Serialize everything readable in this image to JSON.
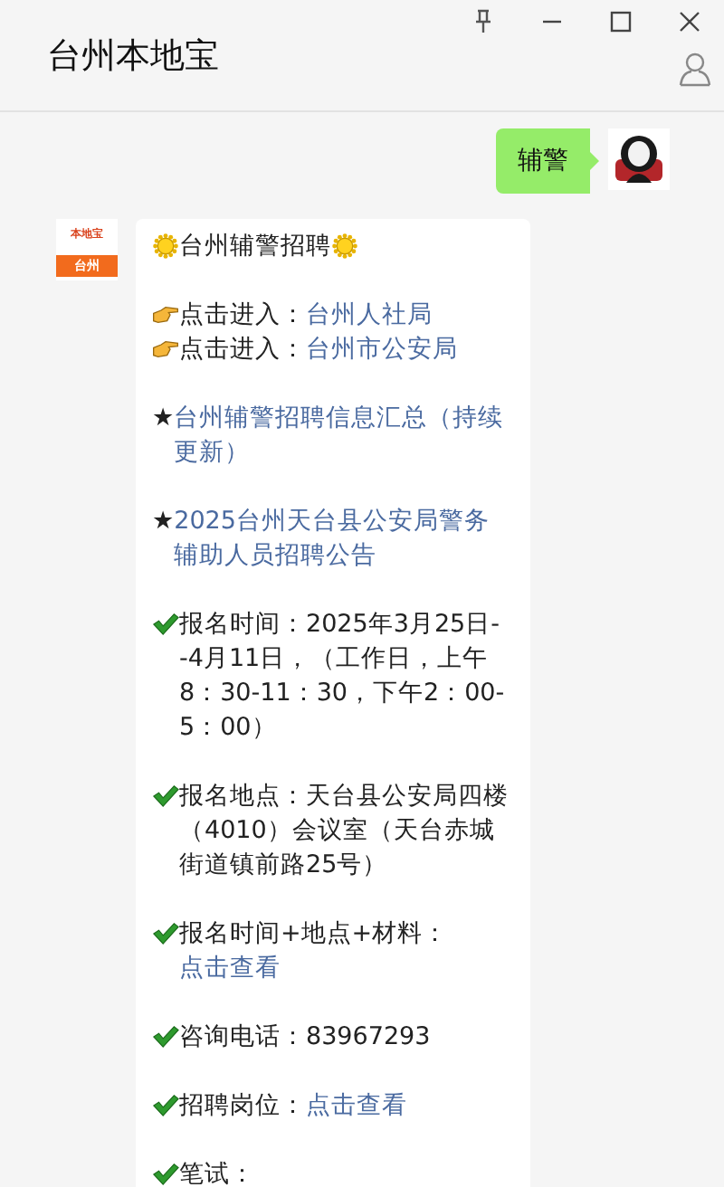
{
  "window": {
    "title": "台州本地宝"
  },
  "messages": [
    {
      "kind": "sent",
      "text": "辅警"
    },
    {
      "kind": "received",
      "logo": {
        "top": "本地宝",
        "bottom": "台州"
      },
      "paragraphs": [
        {
          "lines": [
            {
              "kind": "title",
              "text": "台州辅警招聘"
            }
          ]
        },
        {
          "lines": [
            {
              "kind": "entry",
              "text": "点击进入：",
              "link": "台州人社局"
            },
            {
              "kind": "entry",
              "text": "点击进入：",
              "link": "台州市公安局"
            }
          ]
        },
        {
          "lines": [
            {
              "kind": "bullet_link",
              "text": "★",
              "link": "台州辅警招聘信息汇总（持续更新）"
            }
          ]
        },
        {
          "lines": [
            {
              "kind": "bullet_link",
              "text": "★",
              "link": "2025台州天台县公安局警务辅助人员招聘公告"
            }
          ]
        },
        {
          "lines": [
            {
              "kind": "check",
              "text": "报名时间：2025年3月25日--4月11日，（工作日，上午8：30-11：30，下午2：00-5：00）"
            }
          ]
        },
        {
          "lines": [
            {
              "kind": "check",
              "text": "报名地点：天台县公安局四楼（4010）会议室（天台赤城街道镇前路25号）"
            }
          ]
        },
        {
          "lines": [
            {
              "kind": "check",
              "text": "报名时间+地点+材料：",
              "link": "点击查看"
            }
          ]
        },
        {
          "lines": [
            {
              "kind": "check",
              "text": "咨询电话：83967293"
            }
          ]
        },
        {
          "lines": [
            {
              "kind": "check",
              "text": "招聘岗位：",
              "link": "点击查看"
            }
          ]
        },
        {
          "lines": [
            {
              "kind": "check",
              "text": "笔试："
            }
          ]
        }
      ]
    }
  ]
}
